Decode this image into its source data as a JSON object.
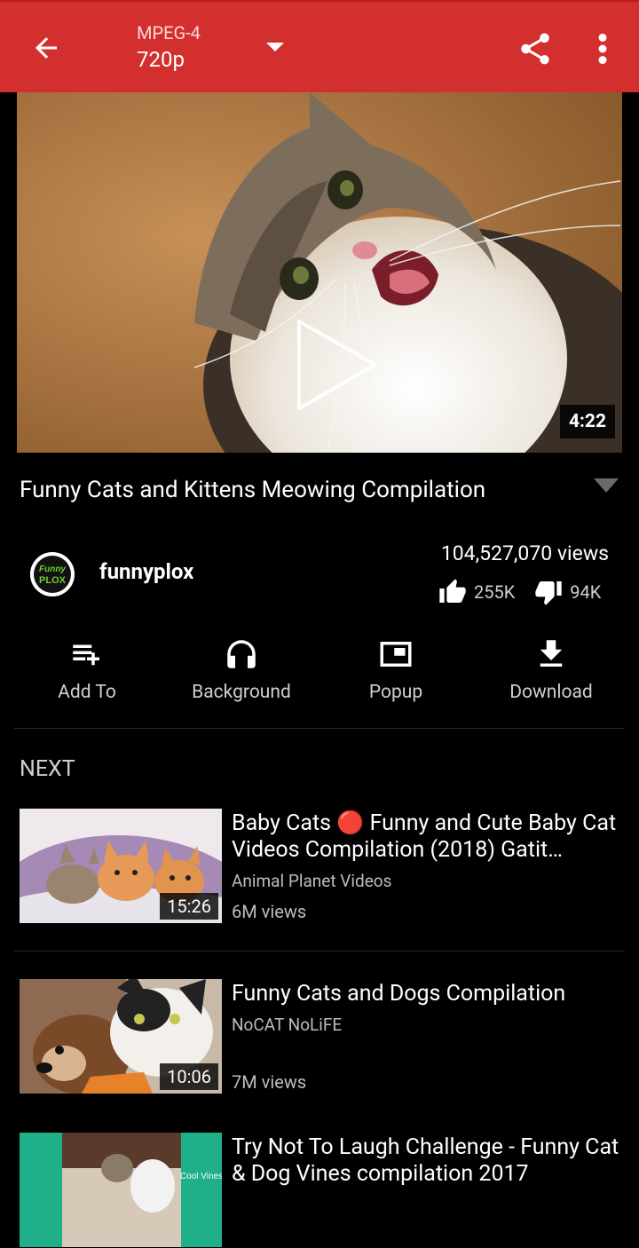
{
  "toolbar": {
    "format": "MPEG-4",
    "quality": "720p"
  },
  "video": {
    "duration": "4:22",
    "title": "Funny Cats and Kittens Meowing Compilation",
    "views": "104,527,070 views",
    "likes": "255K",
    "dislikes": "94K"
  },
  "channel": {
    "name": "funnyplox",
    "avatar_text": "Funny PLOX"
  },
  "actions": [
    {
      "label": "Add To",
      "icon": "playlist-add-icon"
    },
    {
      "label": "Background",
      "icon": "headphones-icon"
    },
    {
      "label": "Popup",
      "icon": "popup-icon"
    },
    {
      "label": "Download",
      "icon": "download-icon"
    }
  ],
  "next": {
    "label": "NEXT",
    "items": [
      {
        "title": "Baby Cats 🔴 Funny and Cute Baby Cat Videos Compilation (2018) Gatit…",
        "channel": "Animal Planet Videos",
        "views": "6M views",
        "duration": "15:26"
      },
      {
        "title": "Funny Cats and Dogs Compilation",
        "channel": "NoCAT NoLiFE",
        "views": "7M views",
        "duration": "10:06"
      },
      {
        "title": "Try Not To Laugh Challenge - Funny Cat & Dog Vines compilation 2017",
        "channel": "",
        "views": "",
        "duration": "",
        "thumb_text": "Cool Vines"
      }
    ]
  },
  "colors": {
    "toolbar": "#d32f2f",
    "background": "#000000"
  }
}
